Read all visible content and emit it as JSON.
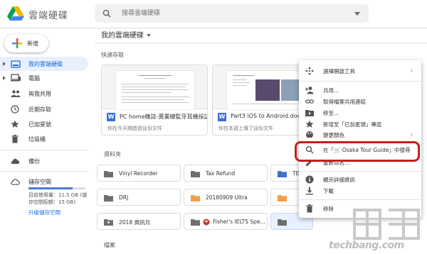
{
  "app": {
    "title": "雲端硬碟"
  },
  "search": {
    "placeholder": "搜尋雲端硬碟"
  },
  "sidebar": {
    "new_label": "新增",
    "items": [
      {
        "label": "我的雲端硬碟",
        "icon": "drive-icon",
        "active": true
      },
      {
        "label": "電腦",
        "icon": "computer-icon"
      },
      {
        "label": "與我共用",
        "icon": "shared-people-icon"
      },
      {
        "label": "近期存取",
        "icon": "clock-icon"
      },
      {
        "label": "已加星號",
        "icon": "star-icon"
      },
      {
        "label": "垃圾桶",
        "icon": "trash-icon"
      },
      {
        "label": "備份",
        "icon": "cloud-icon"
      },
      {
        "label": "儲存空間",
        "icon": "storage-cloud-icon"
      }
    ],
    "storage_text": "目前使用量：11.5 GB (儲存空間配額：15 GB)",
    "storage_fraction": 0.77,
    "upgrade_label": "升級儲存空間"
  },
  "main": {
    "title": "我的雲端硬碟",
    "quick_access_label": "快速存取",
    "folders_label": "資料夾",
    "files_label": "檔案",
    "quick_access": [
      {
        "name": "PC home雜誌-異業線監牙耳機採訪大...",
        "subtitle": "你在今天開啟過這份文件"
      },
      {
        "name": "Part3 iOS to Android.docx",
        "subtitle": "你在本週上傳了這份文件"
      }
    ],
    "folders": [
      {
        "name": "Vinyl Recorder",
        "color": "#6e6e6e"
      },
      {
        "name": "Tax Refund",
        "color": "#6e6e6e"
      },
      {
        "name": "TE",
        "color": "#3f73c9"
      },
      {
        "name": "DRJ",
        "color": "#6e6e6e"
      },
      {
        "name": "20180909 Ultra",
        "color": "#f0a04b"
      },
      {
        "name": "",
        "color": "#f0a04b"
      },
      {
        "name": "2018 資訊月",
        "color": "#6e6e6e"
      },
      {
        "name": "Fisher's IELTS Spe...",
        "color": "#6e6e6e"
      },
      {
        "name": "Osaka Tour Guide",
        "color": "#6e6e6e"
      }
    ]
  },
  "context_menu": {
    "items": [
      {
        "label": "選擇開啟工具",
        "icon": "open-with-icon",
        "has_submenu": true
      },
      {
        "label": "共用...",
        "icon": "add-person-icon"
      },
      {
        "label": "取得檔案共用連結",
        "icon": "link-icon"
      },
      {
        "label": "移至...",
        "icon": "move-folder-icon"
      },
      {
        "label": "新增至「已加星號」專區",
        "icon": "star-icon"
      },
      {
        "label": "變更顏色",
        "icon": "palette-icon",
        "has_submenu": true
      },
      {
        "label": "在「🛒 Osaka Tour Guide」中搜尋",
        "icon": "search-icon"
      },
      {
        "label": "重新命名...",
        "icon": "edit-icon"
      },
      {
        "label": "顯示詳細資訊",
        "icon": "info-icon"
      },
      {
        "label": "下載",
        "icon": "download-icon"
      },
      {
        "label": "移除",
        "icon": "trash-icon"
      }
    ],
    "highlight_color": "#c71e1e"
  },
  "watermark": {
    "domain": "techbang.com"
  }
}
